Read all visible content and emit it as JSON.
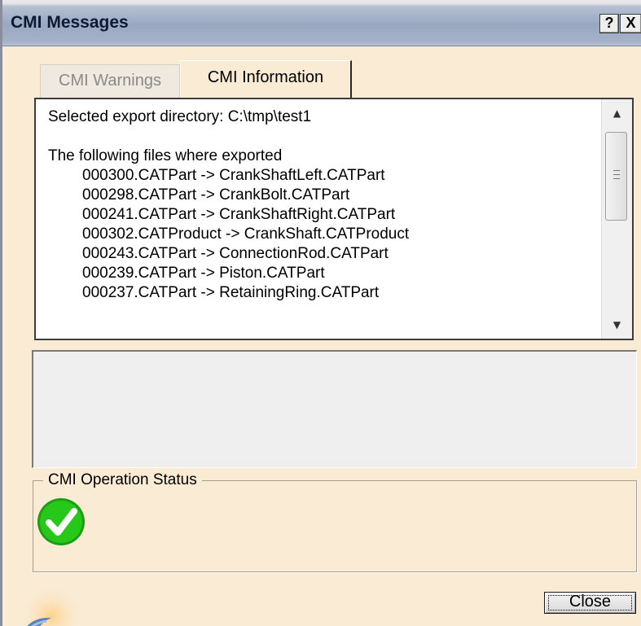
{
  "window": {
    "title": "CMI Messages",
    "help_label": "?",
    "close_label": "X"
  },
  "tabs": [
    {
      "label": "CMI Warnings",
      "active": false
    },
    {
      "label": "CMI Information",
      "active": true
    }
  ],
  "info_panel": {
    "lines": [
      "Selected export directory: C:\\tmp\\test1",
      "",
      "The following files where exported",
      "000300.CATPart -> CrankShaftLeft.CATPart",
      "000298.CATPart -> CrankBolt.CATPart",
      "000241.CATPart -> CrankShaftRight.CATPart",
      "000302.CATProduct -> CrankShaft.CATProduct",
      "000243.CATPart -> ConnectionRod.CATPart",
      "000239.CATPart -> Piston.CATPart",
      "000237.CATPart -> RetainingRing.CATPart"
    ],
    "scroll_up_icon": "▲",
    "scroll_down_icon": "▼"
  },
  "status": {
    "legend": "CMI Operation Status",
    "icon": "success-check-icon",
    "icon_color": "#27c81a"
  },
  "footer": {
    "close_button_label": "Close"
  },
  "colors": {
    "window_bg": "#faebd5",
    "titlebar": "#9aa8c1",
    "title_text": "#0e1a33"
  }
}
